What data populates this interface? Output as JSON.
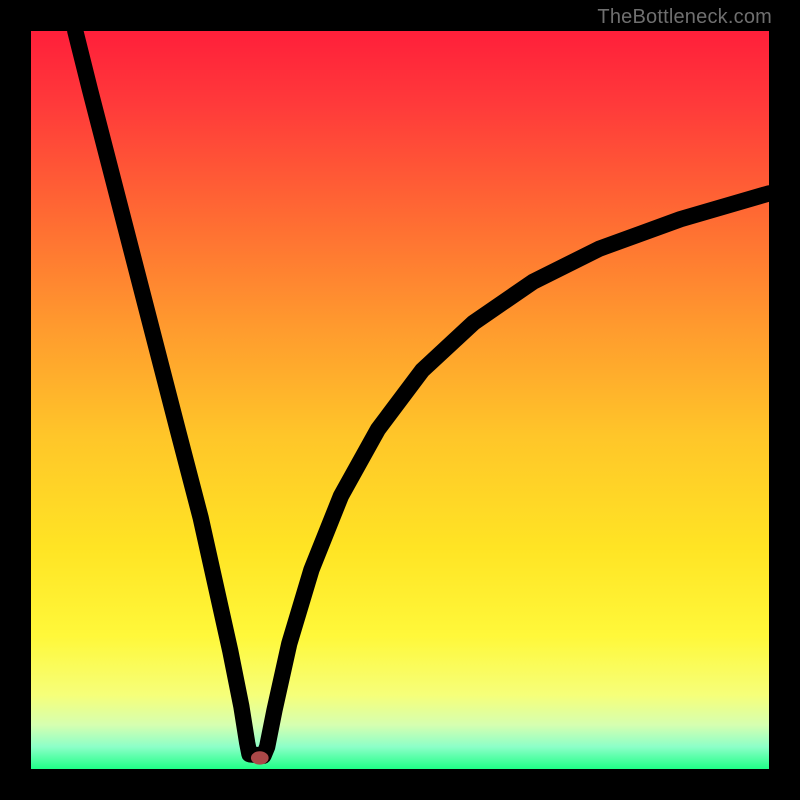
{
  "attribution": "TheBottleneck.com",
  "chart_data": {
    "type": "line",
    "title": "",
    "xlabel": "",
    "ylabel": "",
    "xlim": [
      0,
      100
    ],
    "ylim": [
      0,
      100
    ],
    "marker": {
      "x": 31,
      "y": 1.5,
      "color": "#aa4848"
    },
    "curve": [
      {
        "x": 6.0,
        "y": 100.0
      },
      {
        "x": 8.0,
        "y": 92.0
      },
      {
        "x": 12.0,
        "y": 76.5
      },
      {
        "x": 16.0,
        "y": 61.0
      },
      {
        "x": 20.0,
        "y": 45.5
      },
      {
        "x": 23.0,
        "y": 34.0
      },
      {
        "x": 25.0,
        "y": 25.0
      },
      {
        "x": 27.0,
        "y": 16.0
      },
      {
        "x": 28.5,
        "y": 8.5
      },
      {
        "x": 29.3,
        "y": 3.5
      },
      {
        "x": 29.6,
        "y": 2.0
      },
      {
        "x": 31.5,
        "y": 1.8
      },
      {
        "x": 32.0,
        "y": 3.0
      },
      {
        "x": 33.0,
        "y": 8.0
      },
      {
        "x": 35.0,
        "y": 17.0
      },
      {
        "x": 38.0,
        "y": 27.0
      },
      {
        "x": 42.0,
        "y": 37.0
      },
      {
        "x": 47.0,
        "y": 46.0
      },
      {
        "x": 53.0,
        "y": 54.0
      },
      {
        "x": 60.0,
        "y": 60.5
      },
      {
        "x": 68.0,
        "y": 66.0
      },
      {
        "x": 77.0,
        "y": 70.5
      },
      {
        "x": 88.0,
        "y": 74.5
      },
      {
        "x": 100.0,
        "y": 78.0
      }
    ],
    "gradient_stops": [
      {
        "offset": 0.0,
        "color": "#ff1f3a"
      },
      {
        "offset": 0.1,
        "color": "#ff3a3a"
      },
      {
        "offset": 0.25,
        "color": "#ff6a33"
      },
      {
        "offset": 0.4,
        "color": "#ff9a2e"
      },
      {
        "offset": 0.55,
        "color": "#ffc629"
      },
      {
        "offset": 0.7,
        "color": "#ffe424"
      },
      {
        "offset": 0.82,
        "color": "#fff83a"
      },
      {
        "offset": 0.9,
        "color": "#f6ff7a"
      },
      {
        "offset": 0.94,
        "color": "#d6ffb0"
      },
      {
        "offset": 0.97,
        "color": "#8cffc8"
      },
      {
        "offset": 1.0,
        "color": "#1fff86"
      }
    ]
  }
}
